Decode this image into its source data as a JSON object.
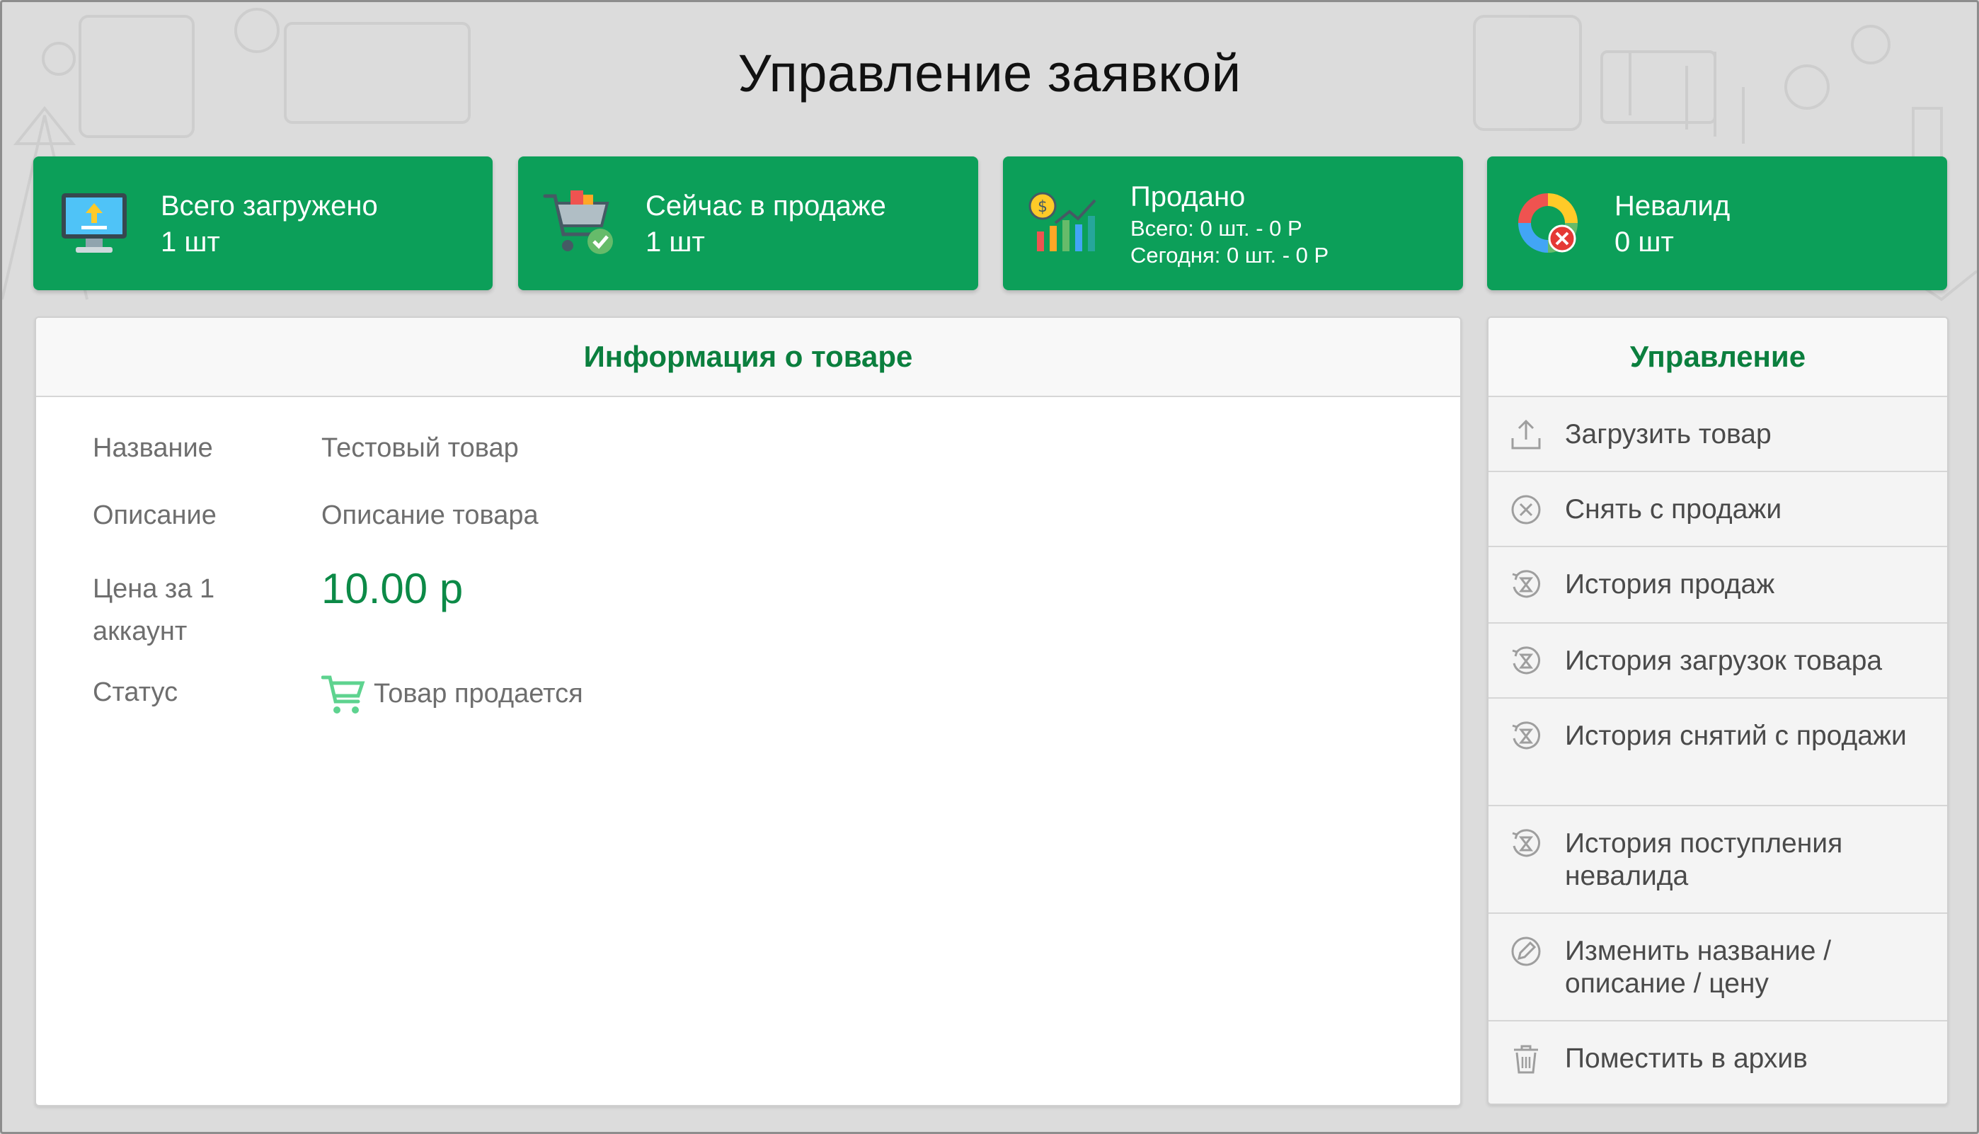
{
  "page": {
    "title": "Управление заявкой"
  },
  "colors": {
    "accent": "#0c9f59",
    "accent_text": "#0b7f3e",
    "background": "#dcdcdc"
  },
  "stats": [
    {
      "label": "Всего загружено",
      "value": "1 шт",
      "icon": "upload-monitor-icon"
    },
    {
      "label": "Сейчас в продаже",
      "value": "1 шт",
      "icon": "cart-check-icon"
    },
    {
      "label": "Продано",
      "total": "Всего: 0 шт. - 0 Р",
      "today": "Сегодня: 0 шт. - 0 Р",
      "icon": "sales-chart-icon"
    },
    {
      "label": "Невалид",
      "value": "0 шт",
      "icon": "invalid-chart-icon"
    }
  ],
  "info": {
    "heading": "Информация о товаре",
    "rows": {
      "name_label": "Название",
      "name_value": "Тестовый товар",
      "desc_label": "Описание",
      "desc_value": "Описание товара",
      "price_label_1": "Цена за 1",
      "price_label_2": "аккаунт",
      "price_value": "10.00 р",
      "status_label": "Статус",
      "status_value": "Товар продается"
    }
  },
  "manage": {
    "heading": "Управление",
    "items": [
      {
        "label": "Загрузить товар",
        "icon": "upload-icon"
      },
      {
        "label": "Снять с продажи",
        "icon": "remove-circle-icon"
      },
      {
        "label": "История продаж",
        "icon": "history-icon"
      },
      {
        "label": "История загрузок товара",
        "icon": "history-icon"
      },
      {
        "label": "История снятий с продажи",
        "icon": "history-icon"
      },
      {
        "label": "История поступления невалида",
        "icon": "history-icon"
      },
      {
        "label": "Изменить название / описание / цену",
        "icon": "edit-icon"
      },
      {
        "label": "Поместить в архив",
        "icon": "trash-icon"
      }
    ]
  }
}
